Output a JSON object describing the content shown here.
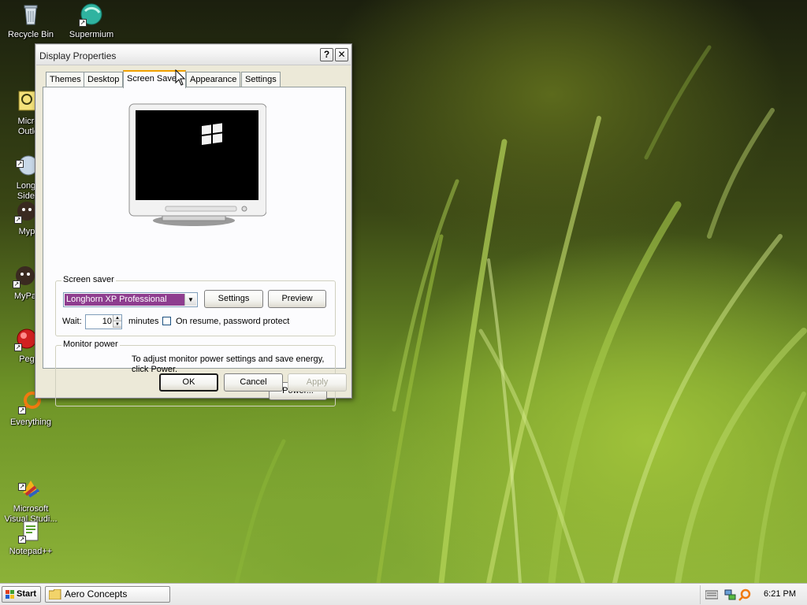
{
  "desktop": {
    "icons": [
      {
        "label": "Recycle Bin"
      },
      {
        "label": "Supermium"
      },
      {
        "label": "Micro\nOutlo"
      },
      {
        "label": "Longh\nSideb"
      },
      {
        "label": "Myp"
      },
      {
        "label": "MyPa"
      },
      {
        "label": "Peg"
      },
      {
        "label": "Everything"
      },
      {
        "label": "Microsoft\nVisual Studi..."
      },
      {
        "label": "Notepad++"
      }
    ]
  },
  "window": {
    "title": "Display Properties",
    "help_label": "?",
    "close_label": "✕",
    "tabs": [
      {
        "label": "Themes"
      },
      {
        "label": "Desktop"
      },
      {
        "label": "Screen Saver"
      },
      {
        "label": "Appearance"
      },
      {
        "label": "Settings"
      }
    ],
    "screensaver": {
      "group_label": "Screen saver",
      "selected": "Longhorn XP Professional",
      "settings_label": "Settings",
      "preview_label": "Preview",
      "wait_label": "Wait:",
      "wait_value": "10",
      "minutes_label": "minutes",
      "password_label": "On resume, password protect"
    },
    "monitor_power": {
      "group_label": "Monitor power",
      "text": "To adjust monitor power settings and save energy, click Power.",
      "power_label": "Power..."
    },
    "buttons": {
      "ok": "OK",
      "cancel": "Cancel",
      "apply": "Apply"
    }
  },
  "taskbar": {
    "start_label": "Start",
    "task_label": "Aero Concepts",
    "clock": "6:21 PM"
  },
  "colors": {
    "selection": "#8e3d8f",
    "tab_accent": "#f0a000",
    "dialog_bg": "#ece9d8"
  }
}
